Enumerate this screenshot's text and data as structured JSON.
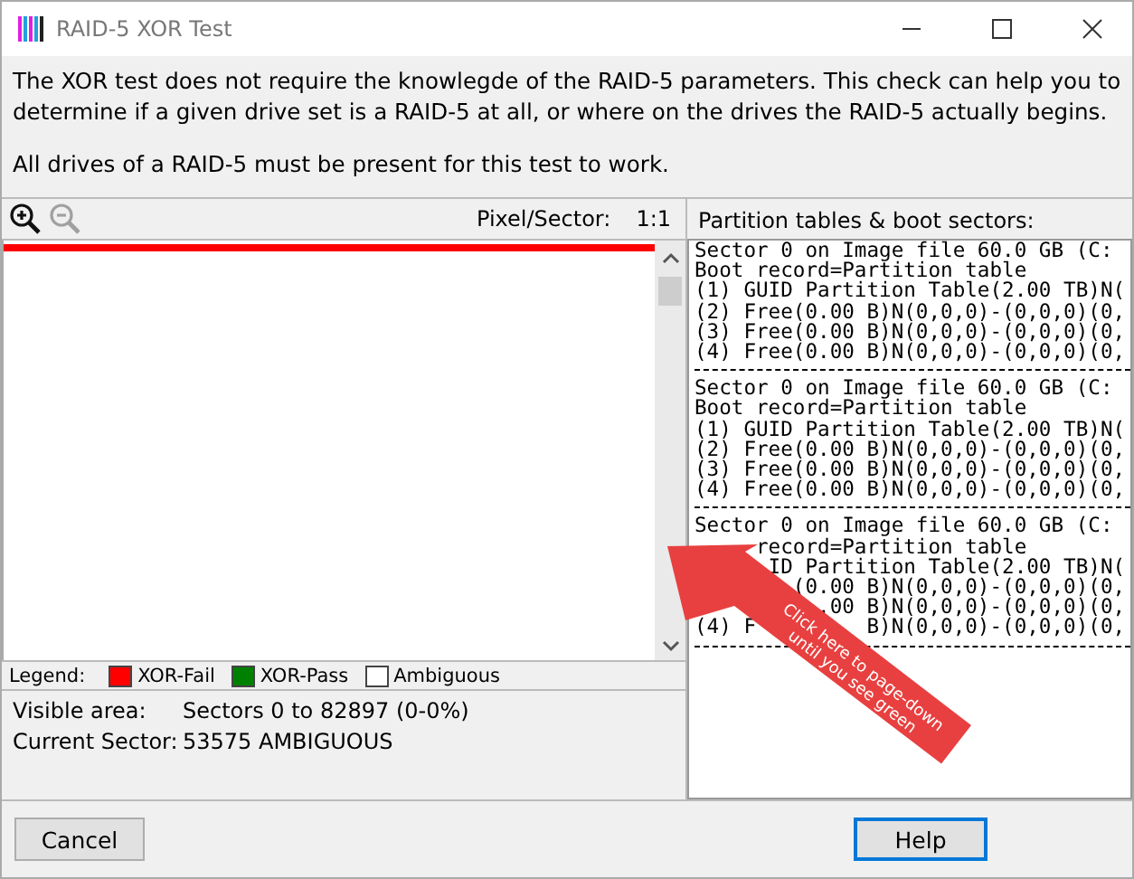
{
  "window": {
    "title": "RAID-5 XOR Test"
  },
  "description": [
    "The XOR test does not require the knowlegde of the RAID-5 parameters. This check can help you to determine if a given drive set is a RAID-5 at all, or where on the drives the RAID-5 actually begins.",
    "All drives of a RAID-5 must be present for this test to work."
  ],
  "toolbar": {
    "zoom_in": {
      "disabled": false
    },
    "zoom_out": {
      "disabled": true
    },
    "scale_label": "Pixel/Sector:",
    "scale_value": "1:1"
  },
  "legend": {
    "label": "Legend:",
    "items": [
      {
        "label": "XOR-Fail",
        "color": "#ff0000"
      },
      {
        "label": "XOR-Pass",
        "color": "#008000"
      },
      {
        "label": "Ambiguous",
        "color": "#ffffff"
      }
    ]
  },
  "info": [
    {
      "label": "Visible area:",
      "value": "Sectors 0 to 82897 (0-0%)"
    },
    {
      "label": "Current Sector:",
      "value": "53575 AMBIGUOUS"
    }
  ],
  "partitions": {
    "title": "Partition tables & boot sectors:",
    "blocks": [
      [
        "Sector 0 on Image file 60.0 GB (C:",
        "Boot record=Partition table",
        "(1) GUID Partition Table(2.00 TB)N(",
        "(2) Free(0.00 B)N(0,0,0)-(0,0,0)(0,",
        "(3) Free(0.00 B)N(0,0,0)-(0,0,0)(0,",
        "(4) Free(0.00 B)N(0,0,0)-(0,0,0)(0,"
      ],
      [
        "Sector 0 on Image file 60.0 GB (C:",
        "Boot record=Partition table",
        "(1) GUID Partition Table(2.00 TB)N(",
        "(2) Free(0.00 B)N(0,0,0)-(0,0,0)(0,",
        "(3) Free(0.00 B)N(0,0,0)-(0,0,0)(0,",
        "(4) Free(0.00 B)N(0,0,0)-(0,0,0)(0,"
      ],
      [
        "Sector 0 on Image file 60.0 GB (C:",
        "     record=Partition table",
        "      ID Partition Table(2.00 TB)N(",
        "        (0.00 B)N(0,0,0)-(0,0,0)(0,",
        "          .00 B)N(0,0,0)-(0,0,0)(0,",
        [
          "(4) F",
          "B)N(0,0,0)-(0,0,0)(0,"
        ]
      ]
    ]
  },
  "callout": {
    "lines": [
      "Click here to page-down",
      "until you see green"
    ]
  },
  "buttons": [
    {
      "label": "Cancel",
      "kind": "cancel"
    },
    {
      "label": "Help",
      "kind": "help"
    }
  ]
}
